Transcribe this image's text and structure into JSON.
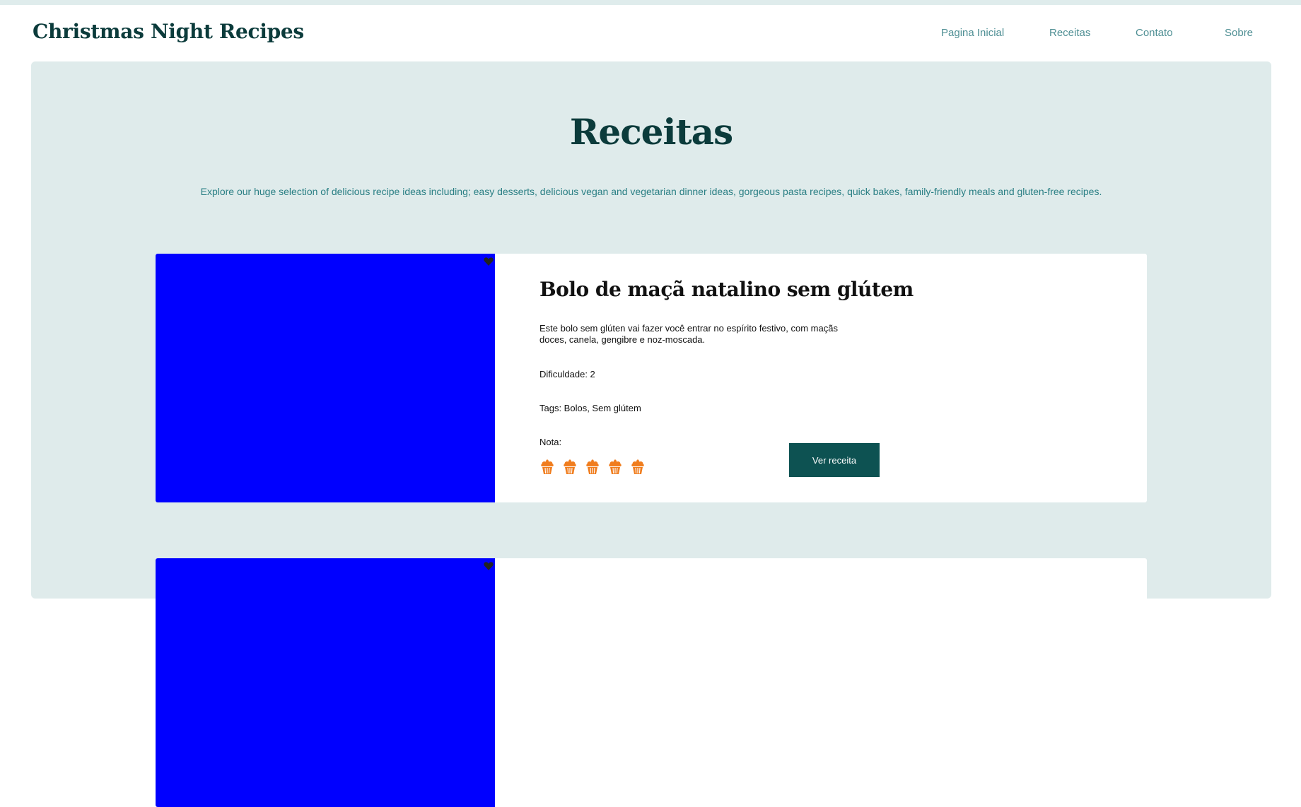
{
  "header": {
    "logo": "Christmas Night Recipes",
    "nav": [
      {
        "label": "Pagina Inicial"
      },
      {
        "label": "Receitas"
      },
      {
        "label": "Contato"
      },
      {
        "label": "Sobre"
      }
    ]
  },
  "page": {
    "title": "Receitas",
    "intro": "Explore our huge selection of delicious recipe ideas including; easy desserts, delicious vegan and vegetarian dinner ideas, gorgeous pasta recipes, quick bakes, family-friendly meals and gluten-free recipes."
  },
  "recipes": [
    {
      "title": "Bolo de maçã natalino sem glútem",
      "description": "Este bolo sem glúten vai fazer você entrar no espírito festivo, com maçãs doces, canela, gengibre e noz-moscada.",
      "difficulty": "Dificuldade: 2",
      "tags": "Tags: Bolos, Sem glútem",
      "rating_label": "Nota:",
      "rating": 5,
      "rating_max": 5,
      "rating_icon": "cupcake-icon",
      "button_label": "Ver receita",
      "image_color": "#0000ff",
      "favorite_icon": "heart-icon"
    },
    {
      "image_color": "#0000ff",
      "favorite_icon": "heart-icon"
    }
  ],
  "colors": {
    "brand_dark": "#0b3b3b",
    "nav_link": "#4f8f94",
    "panel_bg": "#dfebeb",
    "intro_text": "#2a7f84",
    "button_bg": "#0d5252",
    "rating_orange": "#f07d1e"
  }
}
